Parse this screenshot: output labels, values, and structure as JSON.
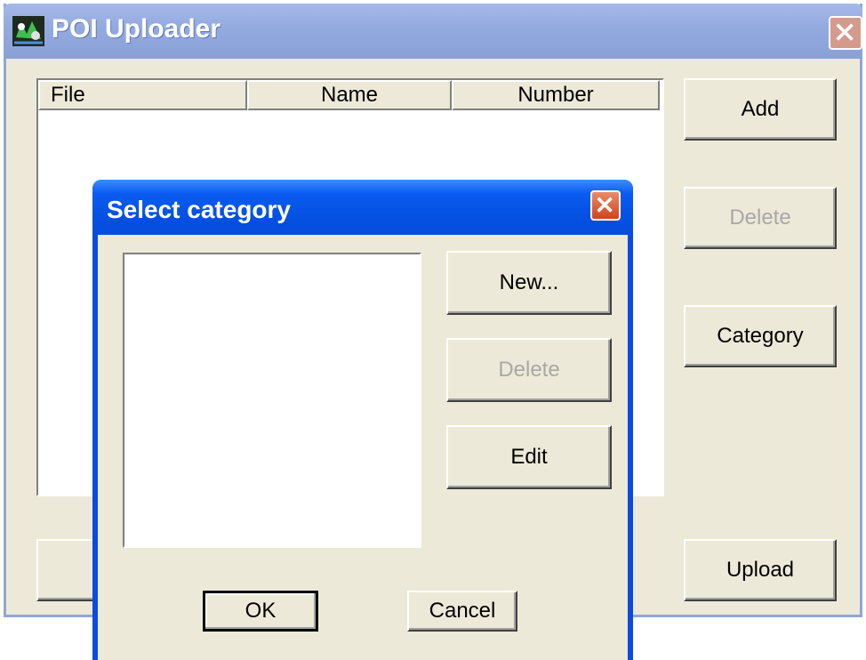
{
  "main_window": {
    "title": "POI Uploader",
    "icon": "poi-app-icon",
    "list": {
      "columns": [
        "File",
        "Name",
        "Number"
      ],
      "rows": []
    },
    "buttons": {
      "add": "Add",
      "delete": "Delete",
      "category": "Category",
      "upload": "Upload"
    }
  },
  "dialog": {
    "title": "Select category",
    "categories": [],
    "buttons": {
      "new": "New...",
      "delete": "Delete",
      "edit": "Edit",
      "ok": "OK",
      "cancel": "Cancel"
    }
  },
  "colors": {
    "inactive_titlebar": "#93aadf",
    "active_titlebar": "#0450e0",
    "dialog_face": "#ece9d8",
    "disabled_text": "#a8a8a8"
  }
}
